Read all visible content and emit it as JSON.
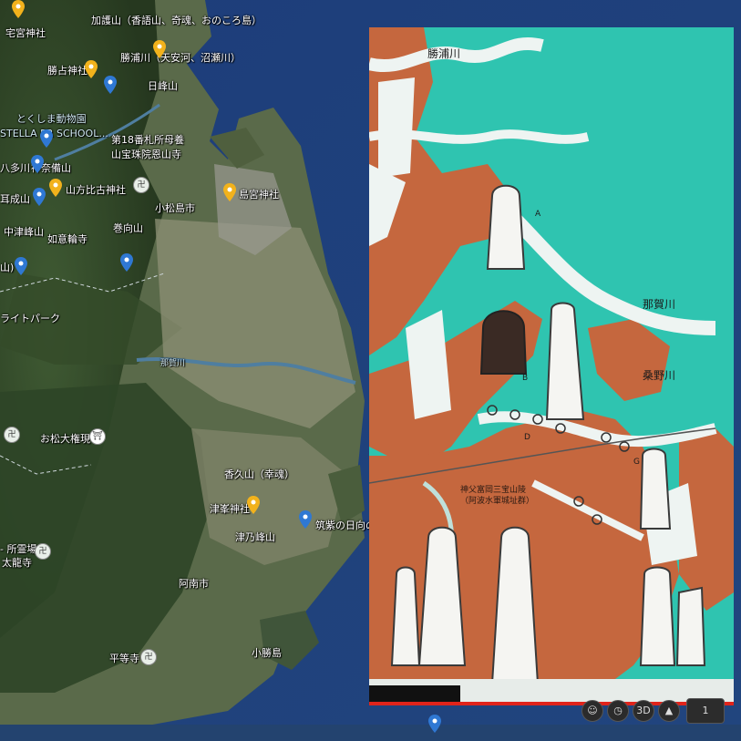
{
  "map": {
    "place_labels": [
      {
        "id": "takumiya",
        "text": "宅宮神社"
      },
      {
        "id": "kagoyama",
        "text": "加護山（香語山、奇魂、おのころ島）"
      },
      {
        "id": "katsura",
        "text": "勝占神社"
      },
      {
        "id": "katsuura",
        "text": "勝浦川（天安河、沼瀬川）"
      },
      {
        "id": "hinomine",
        "text": "日峰山"
      },
      {
        "id": "zoo",
        "text": "とくしま動物園"
      },
      {
        "id": "school",
        "text": "STELLA PR SCHOOL..."
      },
      {
        "id": "fudasho",
        "text": "第18番札所母養"
      },
      {
        "id": "onzanji",
        "text": "山宝珠院恩山寺"
      },
      {
        "id": "hatago",
        "text": "八多川"
      },
      {
        "id": "kannabi",
        "text": "神奈備山"
      },
      {
        "id": "yamakata",
        "text": "山方比古神社"
      },
      {
        "id": "shimamiya",
        "text": "島宮神社"
      },
      {
        "id": "minarisan",
        "text": "耳成山"
      },
      {
        "id": "komatsushima_city",
        "text": "小松島市"
      },
      {
        "id": "nakatsumine",
        "text": "中津峰山"
      },
      {
        "id": "nyoirinji",
        "text": "如意輪寺"
      },
      {
        "id": "makimukuyama",
        "text": "巻向山"
      },
      {
        "id": "yama",
        "text": "山)"
      },
      {
        "id": "lightpark",
        "text": "ライトパーク"
      },
      {
        "id": "nakagawa",
        "text": "那賀川"
      },
      {
        "id": "omatsu",
        "text": "お松大権現"
      },
      {
        "id": "kaguyama",
        "text": "香久山（幸魂）"
      },
      {
        "id": "tsuminejinja",
        "text": "津峯神社"
      },
      {
        "id": "tsunominesan",
        "text": "津乃峰山"
      },
      {
        "id": "tsukushi",
        "text": "筑紫の日向の"
      },
      {
        "id": "reijo",
        "text": "- 所霊場"
      },
      {
        "id": "tairyuji",
        "text": "太龍寺"
      },
      {
        "id": "anan",
        "text": "阿南市"
      },
      {
        "id": "byodoji",
        "text": "平等寺"
      },
      {
        "id": "kokatsushima",
        "text": "小勝島"
      }
    ]
  },
  "overlay": {
    "labels": [
      {
        "id": "katsuura_river",
        "text": "勝浦川"
      },
      {
        "id": "naka_river",
        "text": "那賀川"
      },
      {
        "id": "kuwano_river",
        "text": "桑野川"
      },
      {
        "id": "mark_a",
        "text": "A"
      },
      {
        "id": "mark_b",
        "text": "B"
      },
      {
        "id": "mark_d",
        "text": "D"
      },
      {
        "id": "mark_g",
        "text": "G"
      }
    ],
    "inscription_line1": "神父富岡三宝山陵",
    "inscription_line2": "（阿波水軍城址群）",
    "colors": {
      "sea": "#2fc4b0",
      "land": "#c5673e",
      "river": "#eef4f2"
    }
  },
  "player": {
    "progress": 1.0,
    "progress_color": "#e0241b",
    "controls": [
      "person-icon",
      "clock-icon",
      "3d-button",
      "compass-arrow-icon",
      "fullscreen-button"
    ],
    "label_3d": "3D",
    "label_s": "1"
  }
}
